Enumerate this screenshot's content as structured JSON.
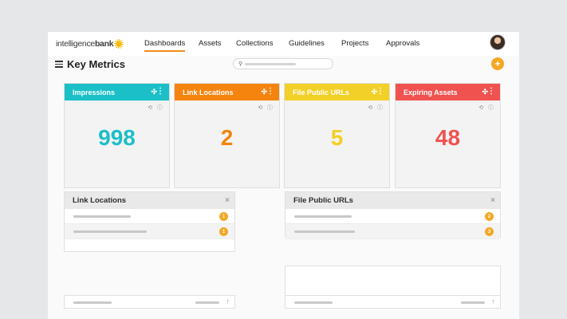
{
  "brand": {
    "logo_text_1": "intelligence",
    "logo_text_2": "bank"
  },
  "nav": {
    "items": [
      {
        "label": "Dashboards",
        "active": true
      },
      {
        "label": "Assets"
      },
      {
        "label": "Collections"
      },
      {
        "label": "Guidelines"
      },
      {
        "label": "Projects"
      },
      {
        "label": "Approvals"
      }
    ]
  },
  "page": {
    "title": "Key Metrics",
    "add_label": "+",
    "search_icon": "search-icon"
  },
  "cards": [
    {
      "title": "Impressions",
      "value": "998",
      "color": "#1bbfc7"
    },
    {
      "title": "Link Locations",
      "value": "2",
      "color": "#f5840f"
    },
    {
      "title": "File Public URLs",
      "value": "5",
      "color": "#f3d028"
    },
    {
      "title": "Expiring Assets",
      "value": "48",
      "color": "#f0524f"
    }
  ],
  "card_icons": {
    "move": "✣",
    "kebab": "⋮",
    "tools": "⟲ ⓘ"
  },
  "panels": [
    {
      "title": "Link Locations",
      "close": "×",
      "rows": [
        {
          "badge": "1"
        },
        {
          "badge": "1"
        }
      ]
    },
    {
      "title": "File Public URLs",
      "close": "×",
      "rows": [
        {
          "badge": "2"
        },
        {
          "badge": "3"
        }
      ]
    }
  ],
  "footer": {
    "up_icon": "↑"
  },
  "colors": {
    "accent": "#f28c1b",
    "badge": "#f5a623"
  }
}
